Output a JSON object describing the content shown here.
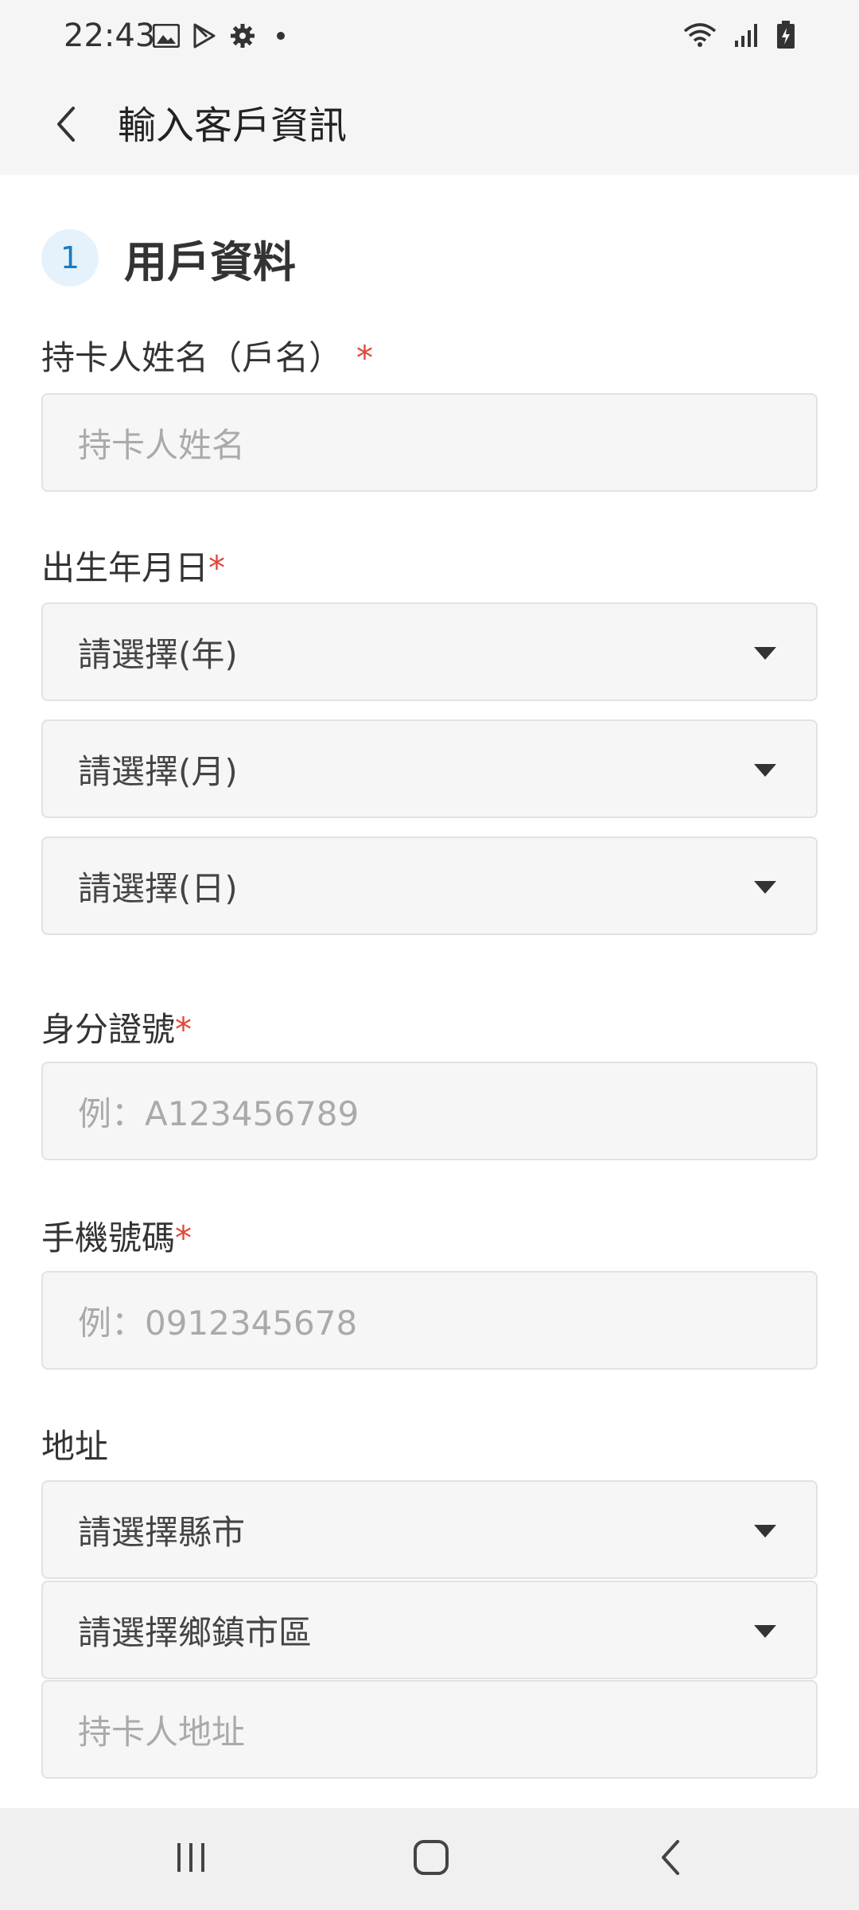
{
  "status_bar": {
    "time": "22:43",
    "left_icons": [
      "image-icon",
      "play-store-icon",
      "settings-gear-icon",
      "dot-icon"
    ],
    "right_icons": [
      "wifi-icon",
      "signal-icon",
      "battery-charging-icon"
    ]
  },
  "app_bar": {
    "title": "輸入客戶資訊",
    "back_icon": "chevron-left-icon"
  },
  "section": {
    "step_number": "1",
    "title": "用戶資料"
  },
  "form": {
    "cardholder_name": {
      "label": "持卡人姓名（戶名）",
      "required_mark": "*",
      "placeholder": "持卡人姓名"
    },
    "birthdate": {
      "label": "出生年月日",
      "required_mark": "*",
      "year_select": "請選擇(年)",
      "month_select": "請選擇(月)",
      "day_select": "請選擇(日)"
    },
    "id_number": {
      "label": "身分證號",
      "required_mark": "*",
      "placeholder": "例：A123456789"
    },
    "mobile": {
      "label": "手機號碼",
      "required_mark": "*",
      "placeholder": "例：0912345678"
    },
    "address": {
      "label": "地址",
      "city_select": "請選擇縣市",
      "district_select": "請選擇鄉鎮市區",
      "placeholder": "持卡人地址"
    }
  },
  "nav_bar": {
    "icons": [
      "recent-apps-icon",
      "home-icon",
      "back-icon"
    ]
  },
  "colors": {
    "accent": "#1a7bc0",
    "badge_bg": "#e6f2fb",
    "required": "#e0473a",
    "field_bg": "#f6f6f6",
    "field_border": "#e2e2e2"
  }
}
